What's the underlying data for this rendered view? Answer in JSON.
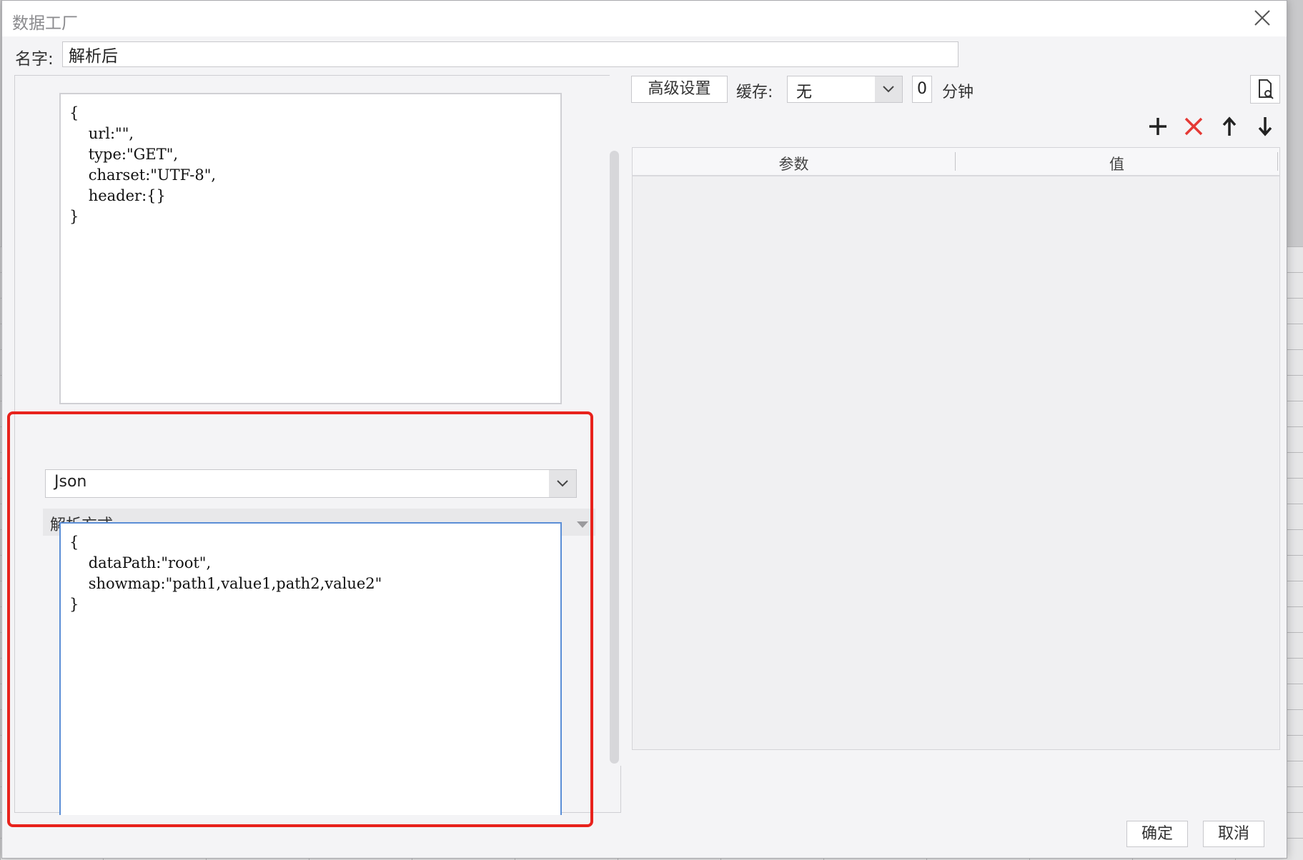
{
  "window": {
    "title": "数据工厂"
  },
  "name_field": {
    "label": "名字:",
    "value": "解析后"
  },
  "request_config": {
    "code": "{\n    url:\"\",\n    type:\"GET\",\n    charset:\"UTF-8\",\n    header:{}\n}"
  },
  "parse_section": {
    "title": "解析方式",
    "mode": "Json",
    "code": "{\n    dataPath:\"root\",\n    showmap:\"path1,value1,path2,value2\"\n}"
  },
  "toolbar": {
    "advanced_label": "高级设置",
    "cache_label": "缓存:",
    "cache_value": "无",
    "minutes_value": "0",
    "minutes_label": "分钟"
  },
  "params_table": {
    "columns": [
      "参数",
      "值"
    ],
    "rows": []
  },
  "footer": {
    "ok_label": "确定",
    "cancel_label": "取消"
  },
  "colors": {
    "highlight": "#e8221c",
    "delete": "#e53935",
    "focus_border": "#5b8ed6"
  },
  "icons": [
    "close-icon",
    "preview-icon",
    "add-icon",
    "delete-icon",
    "move-up-icon",
    "move-down-icon",
    "chevron-down-icon"
  ]
}
